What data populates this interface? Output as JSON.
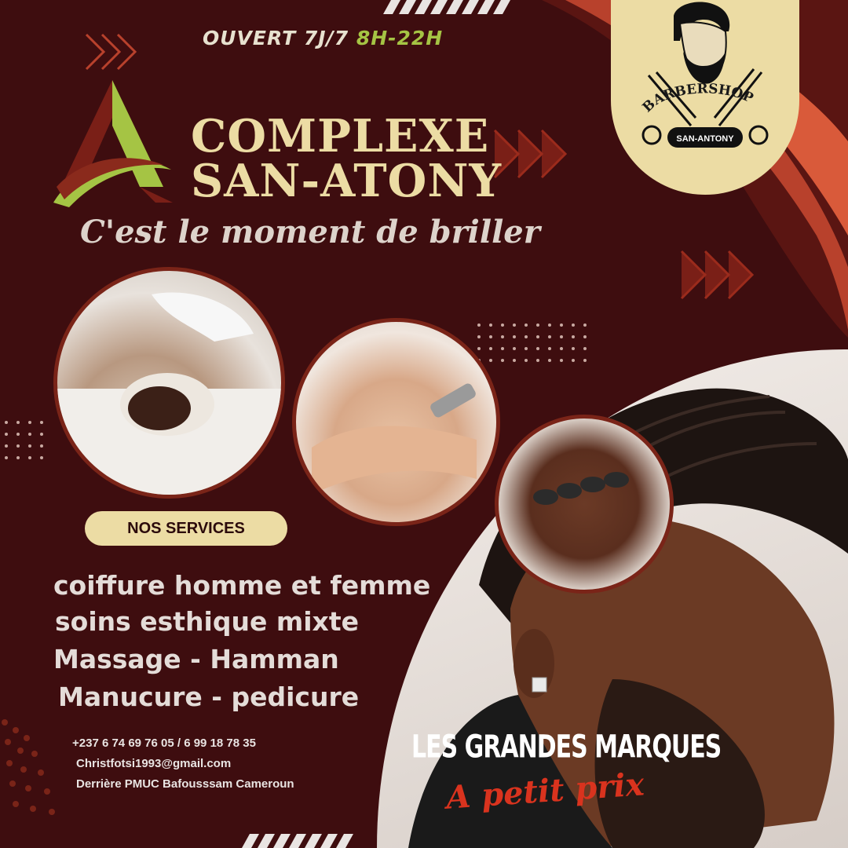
{
  "hours": {
    "prefix": "OUVERT 7J/7",
    "time": "8H-22H"
  },
  "title": {
    "line1": "COMPLEXE",
    "line2": "SAN-ATONY"
  },
  "tagline": "C'est le moment de briller",
  "badge": {
    "word": "BARBERSHOP",
    "name": "SAN-ANTONY"
  },
  "services": {
    "heading": "NOS SERVICES",
    "items": [
      "coiffure homme et femme",
      "soins esthique mixte",
      "Massage - Hamman",
      "Manucure - pedicure"
    ]
  },
  "contact": {
    "phone": "+237 6 74 69 76 05 / 6 99 18 78 35",
    "email": "Christfotsi1993@gmail.com",
    "address": "Derrière PMUC Bafousssam Cameroun"
  },
  "promo": {
    "line1": "LES GRANDES MARQUES",
    "line2": "A petit prix"
  },
  "colors": {
    "background": "#3e0d0f",
    "cream": "#ecdca4",
    "lime": "#a5c444",
    "accent_red": "#d9331e"
  },
  "icons": [
    "logo-a-icon",
    "barber-head-icon",
    "scissors-icon",
    "razor-icon",
    "chevrons-icon"
  ]
}
